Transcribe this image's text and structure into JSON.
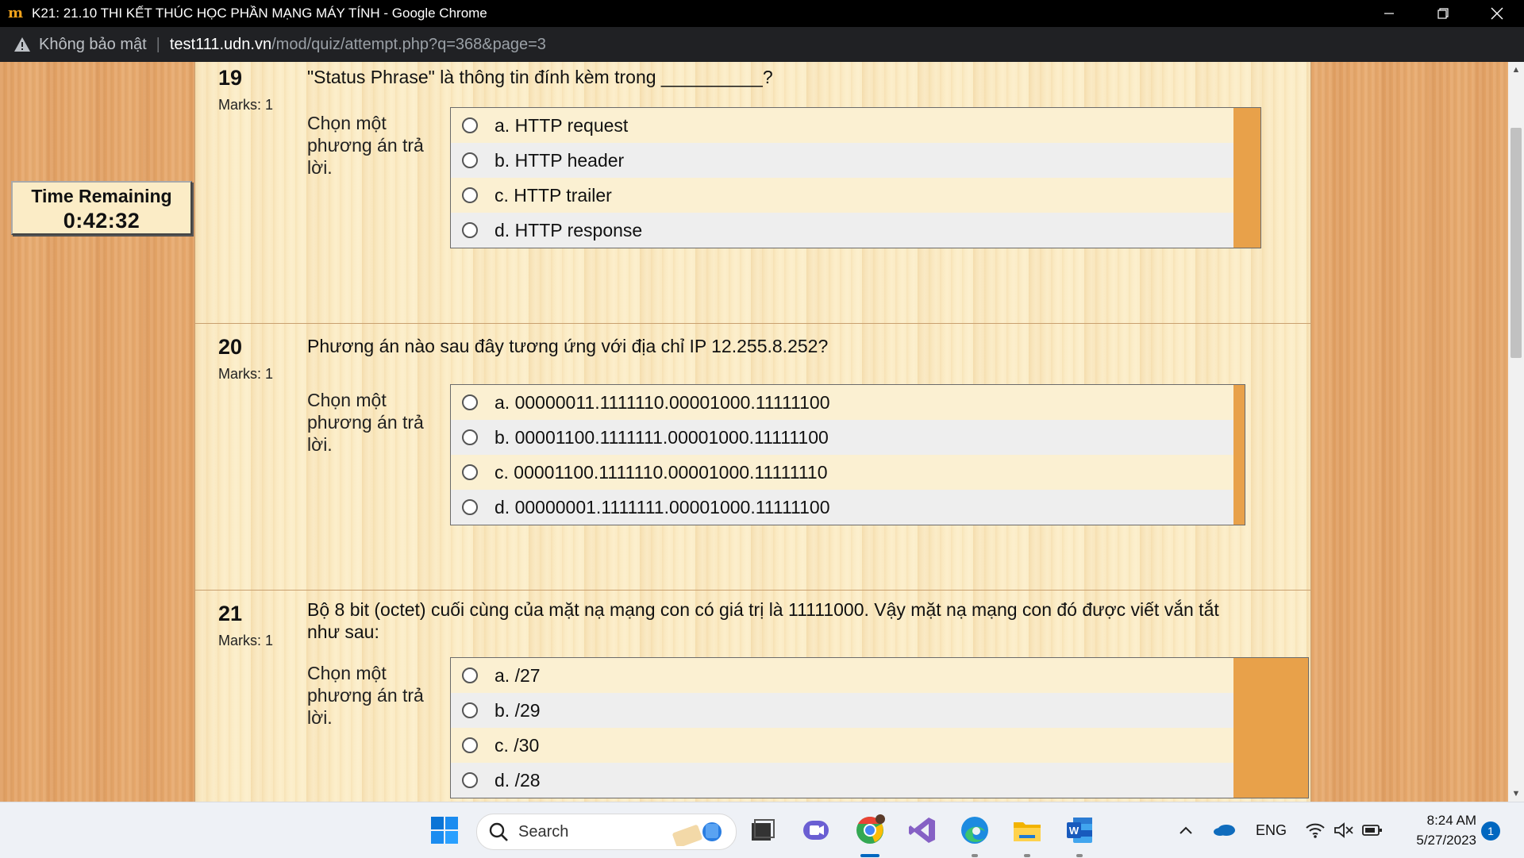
{
  "window": {
    "title": "K21: 21.10 THI KẾT THÚC HỌC PHẦN MẠNG MÁY TÍNH - Google Chrome",
    "app_icon": "moodle-logo",
    "minimize_icon": "minimize-icon",
    "restore_icon": "restore-icon",
    "close_icon": "close-icon"
  },
  "address": {
    "security_text": "Không bảo mật",
    "url_host": "test111.udn.vn",
    "url_path": "/mod/quiz/attempt.php?q=368&page=3"
  },
  "timer": {
    "label": "Time Remaining",
    "value": "0:42:32"
  },
  "questions": [
    {
      "number": "19",
      "marks": "Marks: 1",
      "text": "\"Status Phrase\" là thông tin đính kèm trong __________?",
      "prompt": "Chọn một phương án trả lời.",
      "options": [
        "a. HTTP request",
        "b. HTTP header",
        "c. HTTP trailer",
        "d. HTTP response"
      ]
    },
    {
      "number": "20",
      "marks": "Marks: 1",
      "text": "Phương án nào sau đây tương ứng với địa chỉ IP 12.255.8.252?",
      "prompt": "Chọn một phương án trả lời.",
      "options": [
        "a. 00000011.1111110.00001000.11111100",
        "b. 00001100.1111111.00001000.11111100",
        "c. 00001100.1111110.00001000.11111110",
        "d. 00000001.1111111.00001000.11111100"
      ]
    },
    {
      "number": "21",
      "marks": "Marks: 1",
      "text": "Bộ 8 bit (octet) cuối cùng của mặt nạ mạng con có giá trị là 11111000. Vậy mặt nạ mạng con đó được viết vắn tắt như sau:",
      "prompt": "Chọn một phương án trả lời.",
      "options": [
        "a. /27",
        "b. /29",
        "c. /30",
        "d. /28"
      ]
    }
  ],
  "taskbar": {
    "search_placeholder": "Search",
    "language": "ENG",
    "time": "8:24 AM",
    "date": "5/27/2023",
    "notification_count": "1"
  }
}
